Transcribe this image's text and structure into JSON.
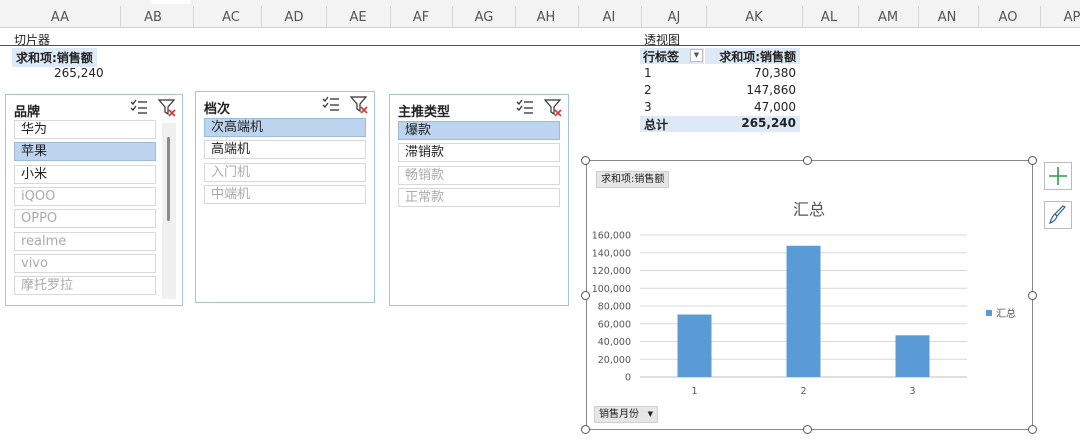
{
  "columns": [
    "AA",
    "AB",
    "AC",
    "AD",
    "AE",
    "AF",
    "AG",
    "AH",
    "AI",
    "AJ",
    "AK",
    "AL",
    "AM",
    "AN",
    "AO",
    "AP"
  ],
  "left_section": {
    "label": "切片器",
    "sum_label": "求和项:销售额",
    "sum_value": "265,240"
  },
  "pivot": {
    "label": "透视图",
    "header_row": "行标签",
    "header_value": "求和项:销售额",
    "rows": [
      {
        "label": "1",
        "value": "70,380"
      },
      {
        "label": "2",
        "value": "147,860"
      },
      {
        "label": "3",
        "value": "47,000"
      }
    ],
    "total_label": "总计",
    "total_value": "265,240"
  },
  "slicers": {
    "brand": {
      "title": "品牌",
      "items": [
        {
          "label": "华为",
          "state": "normal"
        },
        {
          "label": "苹果",
          "state": "selected"
        },
        {
          "label": "小米",
          "state": "normal"
        },
        {
          "label": "iQOO",
          "state": "dim"
        },
        {
          "label": "OPPO",
          "state": "dim"
        },
        {
          "label": "realme",
          "state": "dim"
        },
        {
          "label": "vivo",
          "state": "dim"
        },
        {
          "label": "摩托罗拉",
          "state": "dim"
        }
      ]
    },
    "tier": {
      "title": "档次",
      "items": [
        {
          "label": "次高端机",
          "state": "selected"
        },
        {
          "label": "高端机",
          "state": "normal"
        },
        {
          "label": "入门机",
          "state": "dim"
        },
        {
          "label": "中端机",
          "state": "dim"
        }
      ]
    },
    "promo": {
      "title": "主推类型",
      "items": [
        {
          "label": "爆款",
          "state": "selected"
        },
        {
          "label": "滞销款",
          "state": "normal"
        },
        {
          "label": "畅销款",
          "state": "dim"
        },
        {
          "label": "正常款",
          "state": "dim"
        }
      ]
    }
  },
  "chart": {
    "field_button": "求和项:销售额",
    "axis_button": "销售月份",
    "colors": {
      "bar": "#5b9bd5",
      "grid": "#d9d9d9"
    }
  },
  "chart_data": {
    "type": "bar",
    "title": "汇总",
    "categories": [
      "1",
      "2",
      "3"
    ],
    "series": [
      {
        "name": "汇总",
        "values": [
          70380,
          147860,
          47000
        ]
      }
    ],
    "ylim": [
      0,
      160000
    ],
    "yticks": [
      "0",
      "20,000",
      "40,000",
      "60,000",
      "80,000",
      "100,000",
      "120,000",
      "140,000",
      "160,000"
    ],
    "grid": true,
    "legend": "right"
  }
}
